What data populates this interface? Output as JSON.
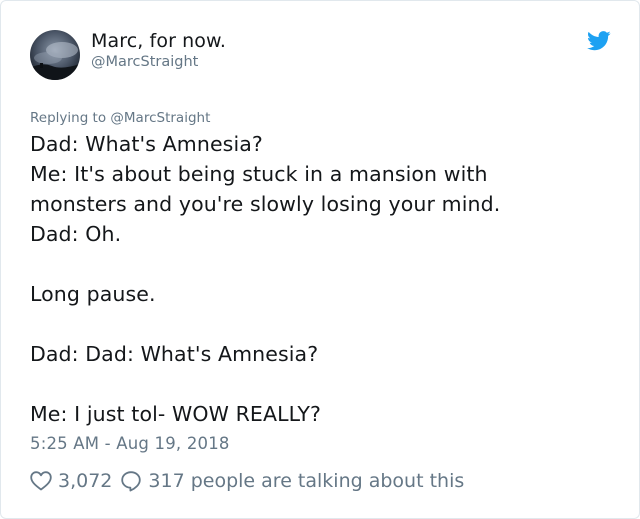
{
  "tweet": {
    "author": {
      "display_name": "Marc, for now.",
      "handle": "@MarcStraight"
    },
    "replying_to_prefix": "Replying to ",
    "replying_to_user": "@MarcStraight",
    "lines": [
      "Dad: What's Amnesia?",
      "Me: It's about being stuck in a mansion with",
      "monsters and you're slowly losing your mind.",
      "Dad: Oh.",
      "",
      "Long pause.",
      "",
      "Dad: Dad: What's Amnesia?",
      "",
      "Me: I just tol- WOW REALLY?"
    ],
    "timestamp": "5:25 AM - Aug 19, 2018",
    "likes": "3,072",
    "talking": "317 people are talking about this"
  },
  "icons": {
    "platform": "twitter-bird-icon",
    "like": "heart-icon",
    "reply": "speech-bubble-icon"
  },
  "colors": {
    "brand": "#1da1f2",
    "text": "#14171a",
    "secondary": "#657786",
    "border": "#e1e8ed"
  }
}
